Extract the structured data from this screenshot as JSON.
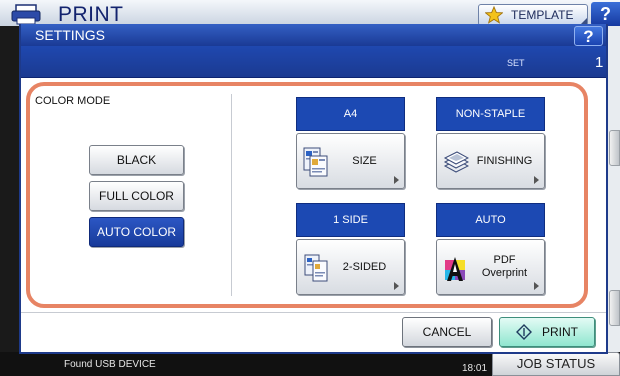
{
  "background": {
    "title": "PRINT",
    "template_button": "TEMPLATE",
    "help_button": "?",
    "job_status_button": "JOB STATUS",
    "status_message": "Found USB DEVICE",
    "time": "18:01"
  },
  "dialog": {
    "title": "SETTINGS",
    "help_button": "?",
    "set_label": "SET",
    "set_count": "1",
    "color_mode": {
      "label": "COLOR MODE",
      "options": [
        "BLACK",
        "FULL COLOR",
        "AUTO COLOR"
      ],
      "selected": "AUTO COLOR"
    },
    "tiles": {
      "size": {
        "value": "A4",
        "label": "SIZE"
      },
      "finishing": {
        "value": "NON-STAPLE",
        "label": "FINISHING"
      },
      "duplex": {
        "value": "1 SIDE",
        "label": "2-SIDED"
      },
      "overprint": {
        "value": "AUTO",
        "label": "PDF Overprint"
      }
    },
    "cancel_button": "CANCEL",
    "print_button": "PRINT"
  },
  "colors": {
    "accent_blue": "#1c49b3",
    "highlight_orange": "#e78464",
    "print_button_green": "#8fe6cf"
  }
}
